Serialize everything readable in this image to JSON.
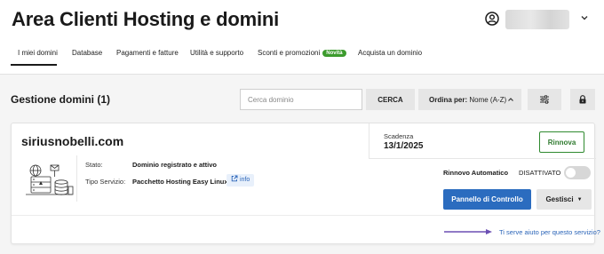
{
  "header": {
    "title": "Area Clienti Hosting e domini",
    "user_name": ""
  },
  "tabs": [
    {
      "label": "I miei domini",
      "active": true
    },
    {
      "label": "Database"
    },
    {
      "label": "Pagamenti e fatture"
    },
    {
      "label": "Utilità e supporto"
    },
    {
      "label": "Sconti e promozioni",
      "badge": "Novità"
    },
    {
      "label": "Acquista un dominio"
    }
  ],
  "toolbar": {
    "section_title": "Gestione domini (1)",
    "search_placeholder": "Cerca dominio",
    "search_value": "",
    "search_button": "CERCA",
    "sort_prefix": "Ordina per:",
    "sort_value": "Nome (A-Z)"
  },
  "domain_card": {
    "domain": "siriusnobelli.com",
    "expiry_label": "Scadenza",
    "expiry_date": "13/1/2025",
    "renew_button": "Rinnova",
    "status_label": "Stato:",
    "status_value": "Dominio registrato e attivo",
    "service_label": "Tipo Servizio:",
    "service_value": "Pacchetto Hosting Easy Linux",
    "info_chip": "info",
    "auto_renew_label": "Rinnovo Automatico",
    "auto_renew_status": "DISATTIVATO",
    "auto_renew_on": false,
    "control_panel_button": "Pannello di Controllo",
    "manage_button": "Gestisci",
    "help_link": "Ti serve aiuto per questo servizio?"
  },
  "colors": {
    "primary_blue": "#2b6cbf",
    "renew_green": "#2f8a2f",
    "badge_green": "#3c9b2d",
    "help_arrow_purple": "#6b4fb3"
  }
}
